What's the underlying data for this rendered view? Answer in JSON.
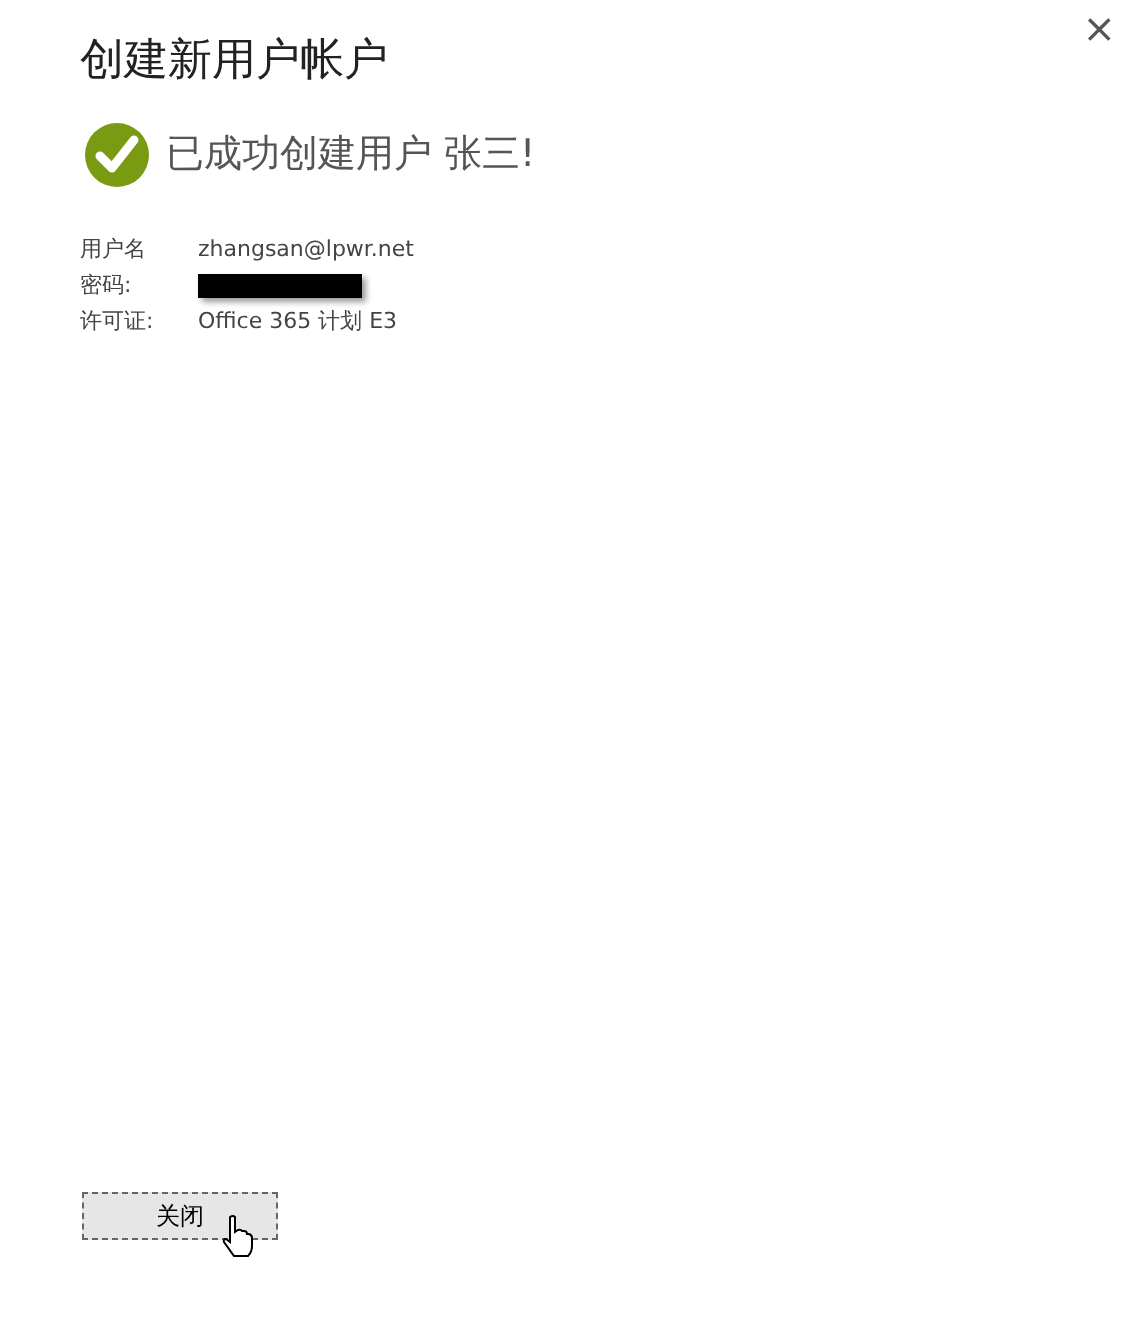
{
  "dialog": {
    "title": "创建新用户帐户",
    "close": "×"
  },
  "message": {
    "kind": "success",
    "text": "已成功创建用户 张三!"
  },
  "details": [
    {
      "label": "用户名",
      "value": "zhangsan@lpwr.net",
      "redacted": false
    },
    {
      "label": "密码:",
      "redacted": true
    },
    {
      "label": "许可证:",
      "value": "Office 365 计划 E3",
      "redacted": false
    }
  ],
  "button": {
    "label": "关闭",
    "focused": true
  }
}
